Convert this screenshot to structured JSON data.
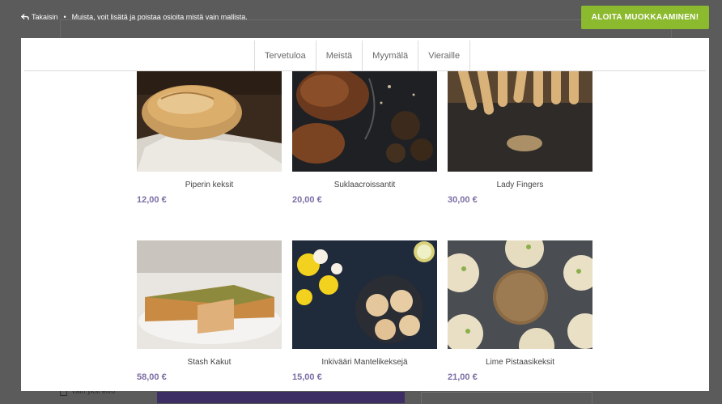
{
  "background": {
    "checkbox_label": "Vain yksi elvo"
  },
  "notice": {
    "back_label": "Takaisin",
    "separator": "•",
    "message": "Muista, voit lisätä ja poistaa osioita mistä vain mallista."
  },
  "start_button_label": "ALOITA MUOKKAAMINEN!",
  "nav": {
    "tabs": [
      {
        "label": "Tervetuloa"
      },
      {
        "label": "Meistä"
      },
      {
        "label": "Myymälä"
      },
      {
        "label": "Vieraille"
      }
    ]
  },
  "products": [
    {
      "name": "Piperin keksit",
      "price": "12,00 €",
      "image": "bread-loaf"
    },
    {
      "name": "Suklaacroissantit",
      "price": "20,00 €",
      "image": "chocolate-croissants"
    },
    {
      "name": "Lady Fingers",
      "price": "30,00 €",
      "image": "lady-fingers"
    },
    {
      "name": "Stash Kakut",
      "price": "58,00 €",
      "image": "quiche-cake"
    },
    {
      "name": "Inkivääri Mantelikeksejä",
      "price": "15,00 €",
      "image": "almond-cookies-flowers"
    },
    {
      "name": "Lime Pistaasikeksit",
      "price": "21,00 €",
      "image": "pistachio-cookies"
    }
  ],
  "colors": {
    "accent_green": "#8cba2e",
    "price_purple": "#7d6ea5",
    "overlay": "#5b5b5b"
  }
}
